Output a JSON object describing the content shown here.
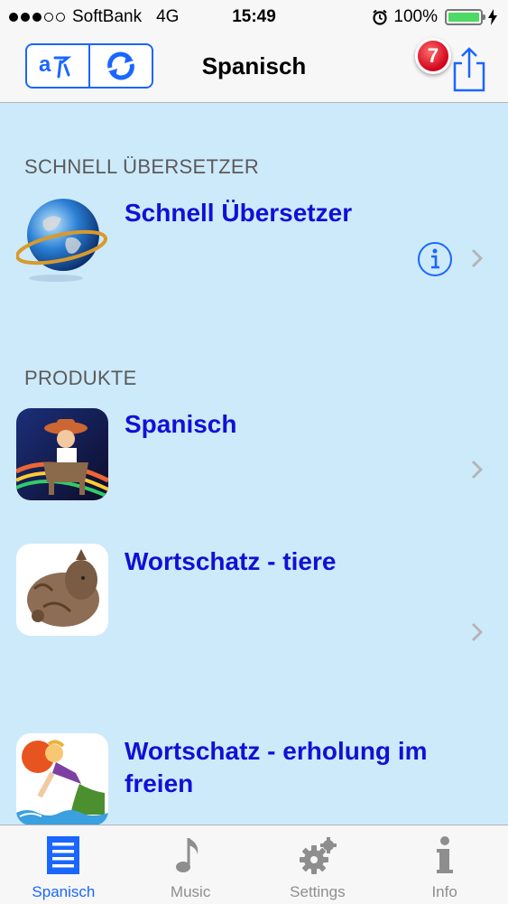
{
  "status_bar": {
    "carrier": "SoftBank",
    "network": "4G",
    "time": "15:49",
    "battery": "100%"
  },
  "nav": {
    "title": "Spanisch",
    "badge_count": "7"
  },
  "sections": {
    "quick_translator_header": "SCHNELL ÜBERSETZER",
    "products_header": "PRODUKTE"
  },
  "rows": [
    {
      "title": "Schnell Übersetzer",
      "icon": "globe-icon"
    },
    {
      "title": "Spanisch",
      "icon": "spanish-product-icon"
    },
    {
      "title": "Wortschatz - tiere",
      "icon": "animal-vocabulary-icon"
    },
    {
      "title": "Wortschatz - erholung im freien",
      "icon": "outdoor-vocabulary-icon"
    }
  ],
  "tabs": [
    {
      "label": "Spanisch",
      "icon": "list-icon",
      "active": true
    },
    {
      "label": "Music",
      "icon": "music-note-icon",
      "active": false
    },
    {
      "label": "Settings",
      "icon": "gear-icon",
      "active": false
    },
    {
      "label": "Info",
      "icon": "info-icon",
      "active": false
    }
  ],
  "colors": {
    "accent": "#1a66ff",
    "title_text": "#1010d6",
    "background": "#cdeafb",
    "badge": "#d0021b"
  }
}
